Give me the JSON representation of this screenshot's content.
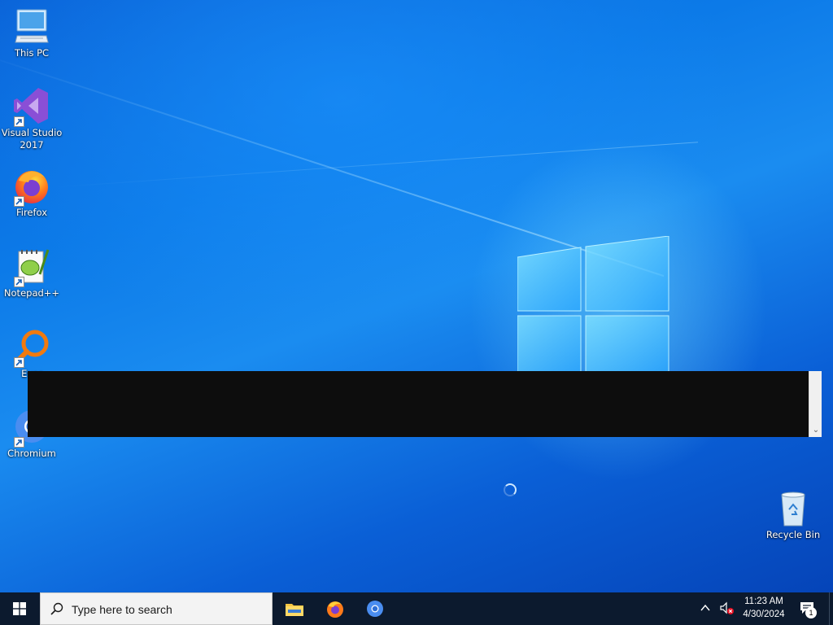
{
  "desktop": {
    "icons": [
      {
        "label": "This PC",
        "icon": "this-pc-icon"
      },
      {
        "label": "Visual Studio 2017",
        "icon": "visual-studio-icon"
      },
      {
        "label": "Firefox",
        "icon": "firefox-icon"
      },
      {
        "label": "Notepad++",
        "icon": "notepad-plus-plus-icon"
      },
      {
        "label": "Ever",
        "icon": "everything-search-icon"
      },
      {
        "label": "Chromium",
        "icon": "chromium-icon"
      },
      {
        "label": "Recycle Bin",
        "icon": "recycle-bin-icon"
      }
    ]
  },
  "taskbar": {
    "search_placeholder": "Type here to search",
    "pinned": [
      {
        "name": "File Explorer",
        "icon": "file-explorer-icon"
      },
      {
        "name": "Firefox",
        "icon": "firefox-icon"
      },
      {
        "name": "Chromium",
        "icon": "chromium-icon"
      }
    ],
    "clock": {
      "time": "11:23 AM",
      "date": "4/30/2024"
    },
    "notification_count": "1"
  },
  "colors": {
    "taskbar_bg": "#0c1a2e",
    "desktop_accent": "#0a63d8",
    "panel_bg": "#0d0d0d"
  }
}
